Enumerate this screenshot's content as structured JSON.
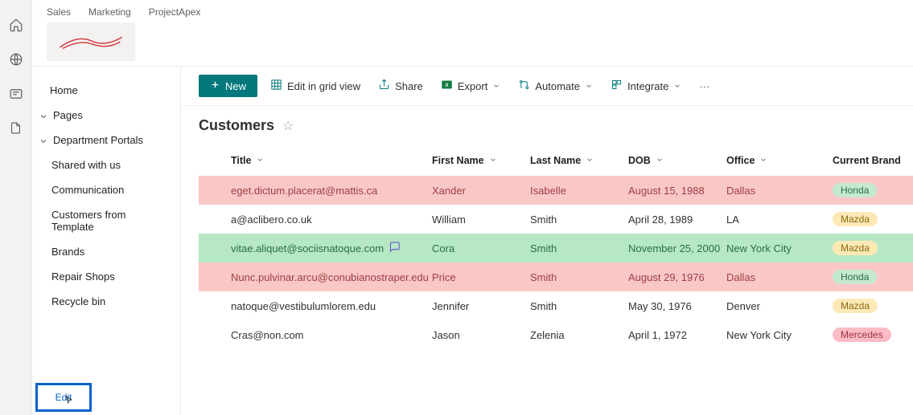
{
  "breadcrumb": [
    "Sales",
    "Marketing",
    "ProjectApex"
  ],
  "sidebar": {
    "home": "Home",
    "groups": [
      {
        "label": "Pages",
        "expanded": true,
        "items": []
      },
      {
        "label": "Department Portals",
        "expanded": true,
        "items": [
          "Shared with us",
          "Communication",
          "Customers from Template",
          "Brands",
          "Repair Shops",
          "Recycle bin"
        ]
      }
    ],
    "edit": "Edit"
  },
  "toolbar": {
    "new": "New",
    "editGrid": "Edit in grid view",
    "share": "Share",
    "export": "Export",
    "automate": "Automate",
    "integrate": "Integrate"
  },
  "page": {
    "title": "Customers"
  },
  "columns": [
    "Title",
    "First Name",
    "Last Name",
    "DOB",
    "Office",
    "Current Brand"
  ],
  "rows": [
    {
      "title": "eget.dictum.placerat@mattis.ca",
      "first": "Xander",
      "last": "Isabelle",
      "dob": "August 15, 1988",
      "office": "Dallas",
      "brand": "Honda",
      "tone": "red",
      "brandTone": "green",
      "comment": false
    },
    {
      "title": "a@aclibero.co.uk",
      "first": "William",
      "last": "Smith",
      "dob": "April 28, 1989",
      "office": "LA",
      "brand": "Mazda",
      "tone": "",
      "brandTone": "yellow",
      "comment": false
    },
    {
      "title": "vitae.aliquet@sociisnatoque.com",
      "first": "Cora",
      "last": "Smith",
      "dob": "November 25, 2000",
      "office": "New York City",
      "brand": "Mazda",
      "tone": "green",
      "brandTone": "yellow",
      "comment": true
    },
    {
      "title": "Nunc.pulvinar.arcu@conubianostraper.edu",
      "first": "Price",
      "last": "Smith",
      "dob": "August 29, 1976",
      "office": "Dallas",
      "brand": "Honda",
      "tone": "red",
      "brandTone": "green",
      "comment": false
    },
    {
      "title": "natoque@vestibulumlorem.edu",
      "first": "Jennifer",
      "last": "Smith",
      "dob": "May 30, 1976",
      "office": "Denver",
      "brand": "Mazda",
      "tone": "",
      "brandTone": "yellow",
      "comment": false
    },
    {
      "title": "Cras@non.com",
      "first": "Jason",
      "last": "Zelenia",
      "dob": "April 1, 1972",
      "office": "New York City",
      "brand": "Mercedes",
      "tone": "",
      "brandTone": "pink",
      "comment": false
    }
  ]
}
